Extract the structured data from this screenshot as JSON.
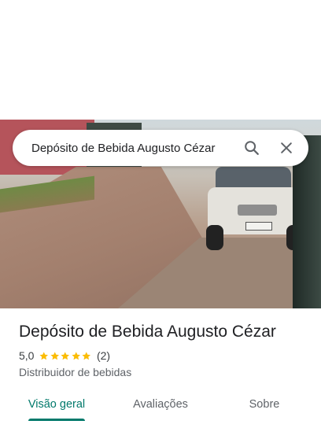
{
  "search": {
    "query": "Depósito de Bebida Augusto Cézar",
    "search_icon": "search-icon",
    "close_icon": "close-icon"
  },
  "place": {
    "name": "Depósito de Bebida Augusto Cézar",
    "rating": "5,0",
    "rating_stars": 5,
    "review_count": "(2)",
    "category": "Distribuidor de bebidas"
  },
  "tabs": [
    {
      "label": "Visão geral",
      "active": true
    },
    {
      "label": "Avaliações",
      "active": false
    },
    {
      "label": "Sobre",
      "active": false
    }
  ],
  "colors": {
    "accent": "#00796b",
    "star": "#fbbc04"
  }
}
